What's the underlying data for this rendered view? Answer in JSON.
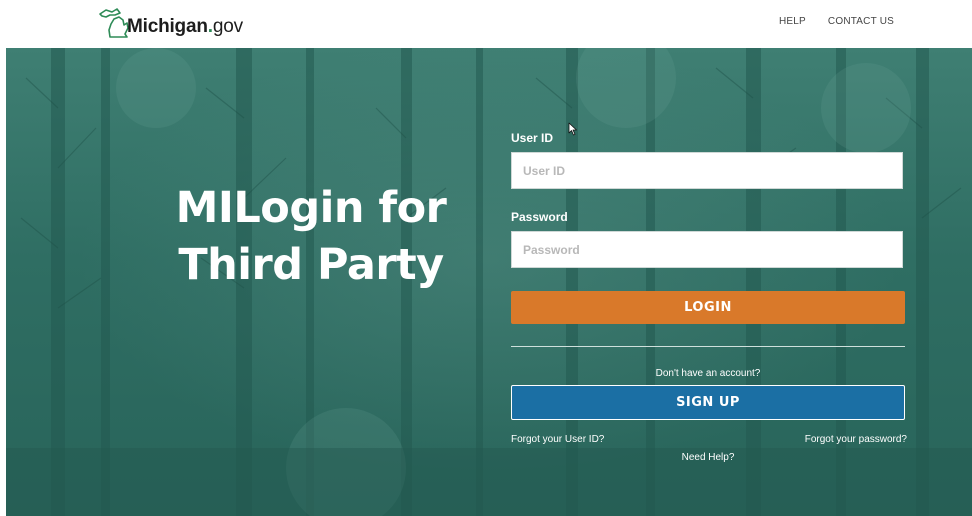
{
  "header": {
    "logo_text_bold": "Michigan",
    "logo_dot": ".",
    "logo_text_gov": "gov",
    "nav": {
      "help": "HELP",
      "contact": "CONTACT US"
    }
  },
  "hero": {
    "title_line1": "MILogin for",
    "title_line2": "Third Party"
  },
  "login_form": {
    "user_id_label": "User ID",
    "user_id_placeholder": "User ID",
    "user_id_value": "",
    "password_label": "Password",
    "password_placeholder": "Password",
    "password_value": "",
    "login_button": "LOGIN",
    "no_account_text": "Don't have an account?",
    "signup_button": "SIGN UP",
    "forgot_user_id": "Forgot your User ID?",
    "forgot_password": "Forgot your password?",
    "need_help": "Need Help?"
  },
  "colors": {
    "hero_green": "#2f6e63",
    "login_orange": "#d9792a",
    "signup_blue": "#1b6fa4"
  },
  "icons": {
    "logo": "michigan-state-outline-icon",
    "cursor": "mouse-pointer-icon"
  }
}
